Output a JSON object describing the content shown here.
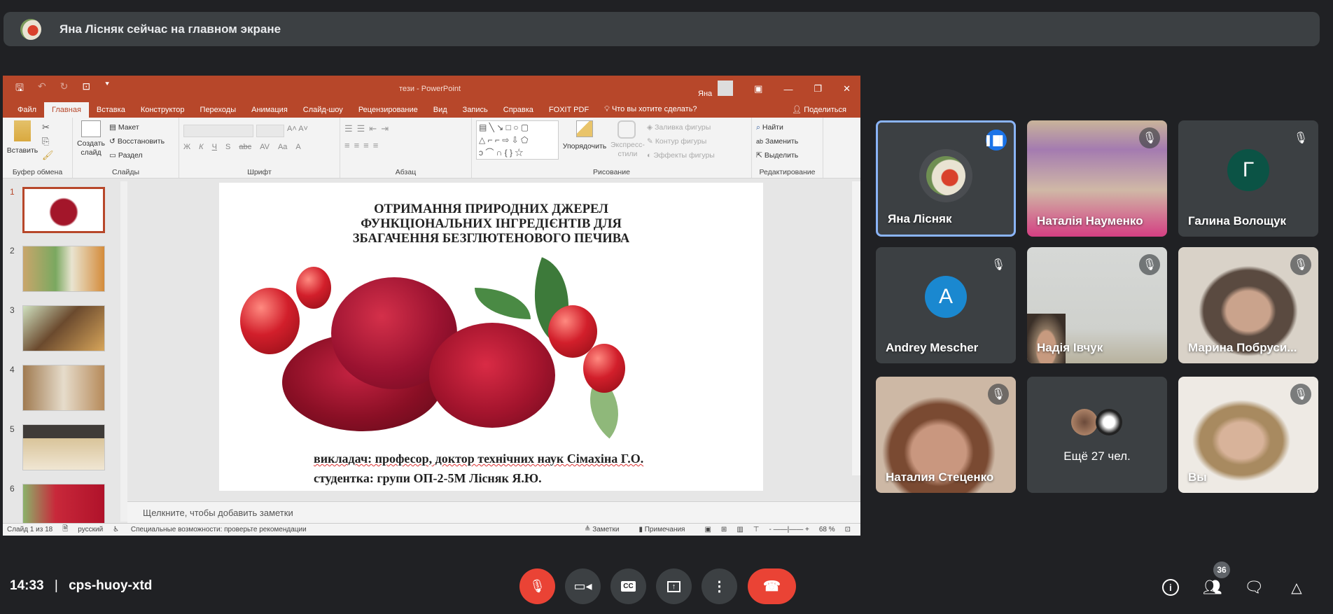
{
  "banner": {
    "text": "Яна Лісняк сейчас на главном экране"
  },
  "ppt": {
    "window_title": "тези  -  PowerPoint",
    "user": "Яна",
    "tabs": [
      "Файл",
      "Главная",
      "Вставка",
      "Конструктор",
      "Переходы",
      "Анимация",
      "Слайд-шоу",
      "Рецензирование",
      "Вид",
      "Запись",
      "Справка",
      "FOXIT PDF"
    ],
    "tell_me": "Что вы хотите сделать?",
    "share": "Поделиться",
    "ribbon": {
      "paste": "Вставить",
      "clipboard": "Буфер обмена",
      "new_slide": "Создать слайд",
      "layout": "Макет",
      "reset": "Восстановить",
      "section": "Раздел",
      "slides": "Слайды",
      "font": "Шрифт",
      "font_buttons": [
        "Ж",
        "К",
        "Ч",
        "S",
        "abc",
        "AV",
        "Aa",
        "A"
      ],
      "paragraph": "Абзац",
      "arrange": "Упорядочить",
      "quick_styles": "Экспресс-стили",
      "shape_fill": "Заливка фигуры",
      "shape_outline": "Контур фигуры",
      "shape_effects": "Эффекты фигуры",
      "drawing": "Рисование",
      "find": "Найти",
      "replace": "Заменить",
      "select": "Выделить",
      "editing": "Редактирование"
    },
    "thumbnails": [
      "1",
      "2",
      "3",
      "4",
      "5",
      "6"
    ],
    "slide": {
      "title_lines": [
        "ОТРИМАННЯ ПРИРОДНИХ ДЖЕРЕЛ",
        "ФУНКЦІОНАЛЬНИХ ІНГРЕДІЄНТІВ ДЛЯ",
        "ЗБАГАЧЕННЯ БЕЗГЛЮТЕНОВОГО ПЕЧИВА"
      ],
      "teacher": "викладач: професор, доктор технічних наук Сімахіна Г.О.",
      "student": "студентка: групи ОП-2-5М Лісняк Я.Ю."
    },
    "notes_placeholder": "Щелкните, чтобы добавить заметки",
    "status": {
      "slide": "Слайд 1 из 18",
      "lang": "русский",
      "accessibility": "Специальные возможности: проверьте рекомендации",
      "notes": "Заметки",
      "comments": "Примечания",
      "zoom": "68 %"
    }
  },
  "participants": [
    {
      "name": "Яна Лісняк",
      "speaking": true
    },
    {
      "name": "Наталія Науменко",
      "muted": true
    },
    {
      "name": "Галина Волощук",
      "muted": true,
      "initial": "Г",
      "color": "#0b5345"
    },
    {
      "name": "Andrey Mescher",
      "muted": true,
      "initial": "A",
      "color": "#1a88d0"
    },
    {
      "name": "Надія Івчук",
      "muted": true
    },
    {
      "name": "Марина Побруси...",
      "muted": true
    },
    {
      "name": "Наталия Стеценко",
      "muted": true
    },
    {
      "name": "Ещё 27 чел."
    },
    {
      "name": "Вы",
      "muted": true
    }
  ],
  "bottom": {
    "time": "14:33",
    "separator": "|",
    "meeting_code": "cps-huoy-xtd",
    "participant_count": "36"
  },
  "colors": {
    "ppt_accent": "#b7472a",
    "meet_red": "#ea4335",
    "speaking_blue": "#1a73e8"
  }
}
